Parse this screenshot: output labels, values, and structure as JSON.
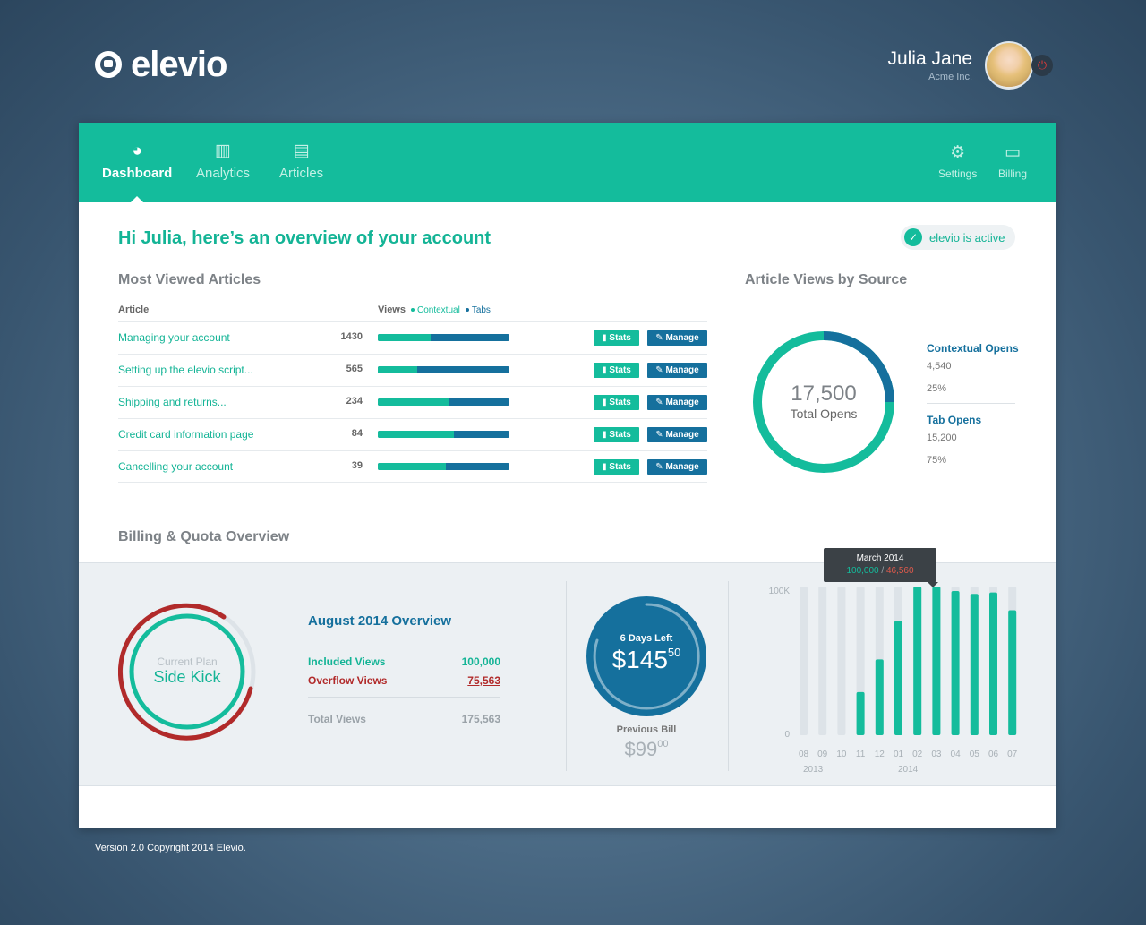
{
  "brand": {
    "name": "elevio"
  },
  "user": {
    "name": "Julia Jane",
    "company": "Acme Inc."
  },
  "nav": {
    "items": [
      {
        "label": "Dashboard",
        "icon": "dashboard-icon"
      },
      {
        "label": "Analytics",
        "icon": "bar-chart-icon"
      },
      {
        "label": "Articles",
        "icon": "document-icon"
      }
    ],
    "right": [
      {
        "label": "Settings",
        "icon": "gear-icon"
      },
      {
        "label": "Billing",
        "icon": "credit-card-icon"
      }
    ]
  },
  "greeting": "Hi Julia, here’s an overview of your account",
  "status": {
    "label": "elevio is active"
  },
  "most_viewed": {
    "title": "Most Viewed Articles",
    "col_article": "Article",
    "col_views": "Views",
    "legend_contextual": "Contextual",
    "legend_tabs": "Tabs",
    "stats_label": "Stats",
    "manage_label": "Manage",
    "rows": [
      {
        "title": "Managing your account",
        "views": "1430",
        "contextual_pct": 40
      },
      {
        "title": "Setting up the elevio script...",
        "views": "565",
        "contextual_pct": 30
      },
      {
        "title": "Shipping and returns...",
        "views": "234",
        "contextual_pct": 54
      },
      {
        "title": "Credit card information page",
        "views": "84",
        "contextual_pct": 58
      },
      {
        "title": "Cancelling your account",
        "views": "39",
        "contextual_pct": 52
      }
    ]
  },
  "sources": {
    "title": "Article Views by Source",
    "total": "17,500",
    "total_label": "Total Opens",
    "contextual": {
      "label": "Contextual Opens",
      "value": "4,540",
      "pct": "25%"
    },
    "tabs": {
      "label": "Tab Opens",
      "value": "15,200",
      "pct": "75%"
    }
  },
  "billing": {
    "title": "Billing & Quota Overview",
    "plan_label": "Current Plan",
    "plan_name": "Side Kick",
    "overview_title": "August 2014 Overview",
    "included_label": "Included Views",
    "included_value": "100,000",
    "overflow_label": "Overflow Views",
    "overflow_value": "75,563",
    "total_label": "Total Views",
    "total_value": "175,563",
    "days_left": "6 Days Left",
    "amount_main": "$145",
    "amount_cents": "50",
    "prev_label": "Previous Bill",
    "prev_main": "$99",
    "prev_cents": "00",
    "tooltip_title": "March 2014",
    "tooltip_included": "100,000",
    "tooltip_sep": "/",
    "tooltip_overflow": "46,560"
  },
  "colors": {
    "teal": "#14bc9c",
    "blue": "#15709d",
    "red": "#b12a2a"
  },
  "chart_data": {
    "type": "bar",
    "ylabel": "",
    "y_ticks": [
      "100K",
      "0"
    ],
    "ylim": [
      0,
      100000
    ],
    "categories": [
      "08",
      "09",
      "10",
      "11",
      "12",
      "01",
      "02",
      "03",
      "04",
      "05",
      "06",
      "07"
    ],
    "year_labels": [
      "2013",
      "2014"
    ],
    "values": [
      0,
      0,
      0,
      29000,
      51000,
      77000,
      100000,
      100000,
      97000,
      95000,
      96000,
      84000
    ]
  },
  "footer": "Version 2.0 Copyright 2014 Elevio."
}
